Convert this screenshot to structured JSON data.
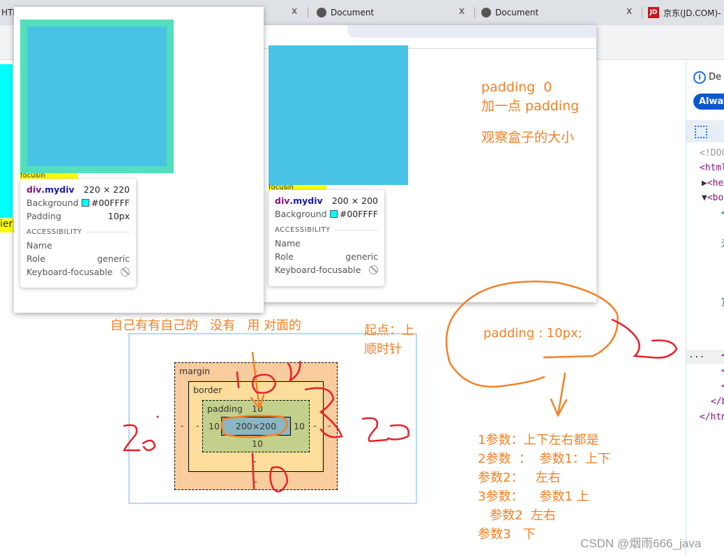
{
  "tabs": [
    {
      "label": "HTML"
    },
    {
      "label": "Document"
    },
    {
      "label": "Document"
    },
    {
      "label": "京东(JD.COM)-"
    }
  ],
  "tab_close": "x",
  "jd_logo": "JD",
  "left_label": "ier",
  "window1": {
    "label": "focusin",
    "tooltip": {
      "selector_tag": "div",
      "selector_class": ".mydiv",
      "size": "220 × 220",
      "background_label": "Background",
      "background_value": "#00FFFF",
      "padding_label": "Padding",
      "padding_value": "10px",
      "accessibility": "ACCESSIBILITY",
      "name_label": "Name",
      "role_label": "Role",
      "role_value": "generic",
      "focusable_label": "Keyboard-focusable"
    }
  },
  "window2": {
    "label": "focusin",
    "tooltip": {
      "selector_tag": "div",
      "selector_class": ".mydiv",
      "size": "200 × 200",
      "background_label": "Background",
      "background_value": "#00FFFF",
      "accessibility": "ACCESSIBILITY",
      "name_label": "Name",
      "role_label": "Role",
      "role_value": "generic",
      "focusable_label": "Keyboard-focusable"
    },
    "notes": [
      "padding  0",
      "加一点 padding",
      "",
      "观察盒子的大小"
    ]
  },
  "annotations": {
    "rule": "自己有有自己的   没有   用 对面的",
    "start": "起点：上",
    "clockwise": "顺时针",
    "padding_decl": "padding : 10px;",
    "params": [
      "1参数：上下左右都是",
      "2参数  ：  参数1：上下",
      "参数2：   左右",
      "3参数：    参数1 上",
      "   参数2  左右",
      "参数3   下"
    ]
  },
  "box_model": {
    "margin": "margin",
    "border": "border",
    "padding": "padding",
    "padding_top": "10",
    "padding_right": "10",
    "padding_bottom": "10",
    "padding_left": "10",
    "content": "200×200",
    "dash": "-"
  },
  "devtools": {
    "info": "De",
    "always_button": "Alway",
    "lines": [
      "<!DOC",
      "<html",
      "<he",
      "<bo",
      "<",
      "元",
      "宽",
      "<",
      "<",
      "<",
      "</b",
      "</htm"
    ],
    "ellipsis": "..."
  },
  "watermark": "CSDN @烟雨666_java",
  "colors": {
    "cyan": "#00FFFF",
    "content_blue": "#48C3E6",
    "padding_green": "#52DFBB",
    "annotation_orange": "#F58026",
    "scribble_red": "#E8202A"
  }
}
